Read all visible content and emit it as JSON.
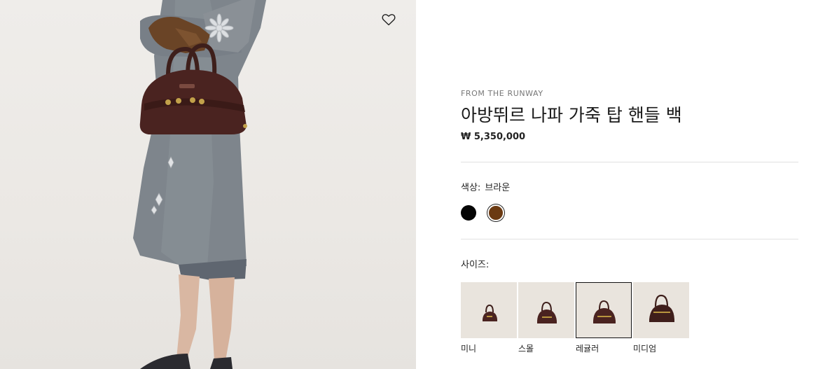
{
  "product": {
    "eyebrow": "FROM THE RUNWAY",
    "title": "아방뛰르 나파 가죽 탑 핸들 백",
    "price": "₩ 5,350,000"
  },
  "color": {
    "label": "색상:",
    "selected": "브라운",
    "options": [
      {
        "name": "블랙",
        "hex": "#050505"
      },
      {
        "name": "브라운",
        "hex": "#6b3a12"
      }
    ]
  },
  "size": {
    "label": "사이즈:",
    "selected": "레귤러",
    "options": [
      {
        "label": "미니"
      },
      {
        "label": "스몰"
      },
      {
        "label": "레귤러"
      },
      {
        "label": "미디엄"
      }
    ]
  },
  "icons": {
    "wishlist": "heart-outline-icon"
  },
  "colors": {
    "text": "#1a1a1a",
    "muted": "#777777",
    "divider": "#e1e1e1",
    "bag_brown": "#4a2320"
  }
}
